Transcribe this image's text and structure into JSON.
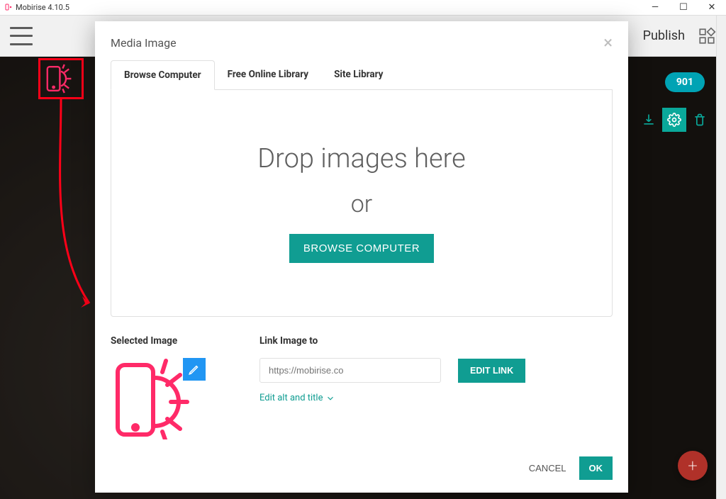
{
  "window": {
    "title": "Mobirise 4.10.5"
  },
  "topbar": {
    "publish_label": "Publish"
  },
  "badge": {
    "value": "901"
  },
  "modal": {
    "title": "Media Image",
    "tabs": [
      {
        "label": "Browse Computer"
      },
      {
        "label": "Free Online Library"
      },
      {
        "label": "Site Library"
      }
    ],
    "dropzone": {
      "drop_text": "Drop images here",
      "or_text": "or",
      "browse_btn": "BROWSE COMPUTER"
    },
    "selected_label": "Selected Image",
    "link_label": "Link Image to",
    "link_placeholder": "https://mobirise.co",
    "edit_link_btn": "EDIT LINK",
    "edit_alt_label": "Edit alt and title",
    "footer": {
      "cancel": "CANCEL",
      "ok": "OK"
    }
  },
  "colors": {
    "teal": "#109d92",
    "annotation_red": "#ff0018",
    "logo_pink": "#ff2a68",
    "blue": "#2196f3"
  }
}
